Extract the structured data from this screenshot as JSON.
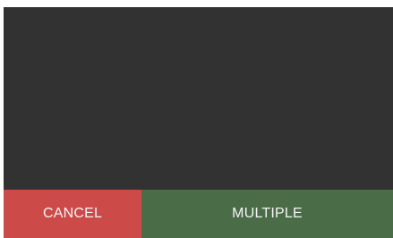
{
  "dialog": {
    "buttons": {
      "cancel_label": "CANCEL",
      "multiple_label": "MULTIPLE"
    },
    "colors": {
      "surface": "#323232",
      "cancel": "#cc4a48",
      "multiple": "#4a6d48",
      "button_text": "#f4f4f4"
    }
  }
}
